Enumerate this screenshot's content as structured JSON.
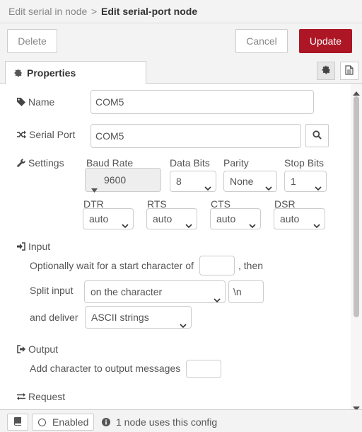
{
  "breadcrumb": {
    "parent": "Edit serial in node",
    "separator": ">",
    "current": "Edit serial-port node"
  },
  "toolbar": {
    "delete_label": "Delete",
    "cancel_label": "Cancel",
    "update_label": "Update"
  },
  "tabs": {
    "properties_label": "Properties",
    "icons": [
      "gear-icon",
      "description-icon"
    ]
  },
  "form": {
    "name_label": "Name",
    "name_value": "COM5",
    "serial_port_label": "Serial Port",
    "serial_port_value": "COM5",
    "settings_label": "Settings",
    "baud_rate_label": "Baud Rate",
    "baud_rate_value": "9600",
    "data_bits_label": "Data Bits",
    "data_bits_value": "8",
    "parity_label": "Parity",
    "parity_value": "None",
    "stop_bits_label": "Stop Bits",
    "stop_bits_value": "1",
    "dtr_label": "DTR",
    "dtr_value": "auto",
    "rts_label": "RTS",
    "rts_value": "auto",
    "cts_label": "CTS",
    "cts_value": "auto",
    "dsr_label": "DSR",
    "dsr_value": "auto",
    "input_section_label": "Input",
    "start_char_text": "Optionally wait for a start character of",
    "start_char_value": "",
    "then_text": ", then",
    "split_label": "Split input",
    "split_value": "on the character",
    "split_char_value": "\\n",
    "deliver_label": "and deliver",
    "deliver_value": "ASCII strings",
    "output_section_label": "Output",
    "add_char_text": "Add character to output messages",
    "add_char_value": "",
    "request_section_label": "Request"
  },
  "footer": {
    "enabled_label": "Enabled",
    "usage_text": "1 node uses this config"
  },
  "colors": {
    "primary": "#ad1625",
    "header_bg": "#f3f3f3",
    "border": "#cccccc"
  }
}
